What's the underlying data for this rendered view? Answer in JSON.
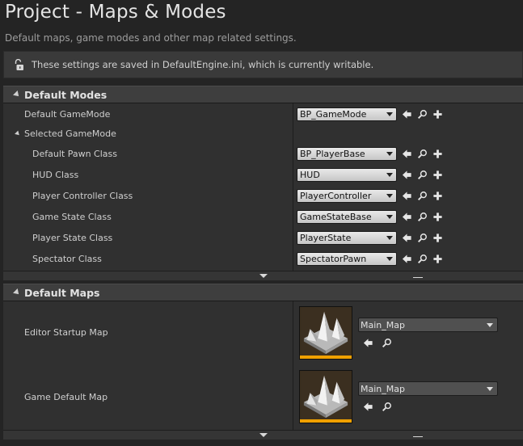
{
  "page": {
    "title": "Project - Maps & Modes",
    "subtitle": "Default maps, game modes and other map related settings."
  },
  "notice": {
    "text": "These settings are saved in DefaultEngine.ini, which is currently writable.",
    "icon": "unlocked-padlock-icon"
  },
  "default_modes": {
    "header": "Default Modes",
    "default_gamemode": {
      "label": "Default GameMode",
      "value": "BP_GameMode"
    },
    "selected_gamemode": {
      "label": "Selected GameMode",
      "rows": [
        {
          "label": "Default Pawn Class",
          "value": "BP_PlayerBase"
        },
        {
          "label": "HUD Class",
          "value": "HUD"
        },
        {
          "label": "Player Controller Class",
          "value": "PlayerController"
        },
        {
          "label": "Game State Class",
          "value": "GameStateBase"
        },
        {
          "label": "Player State Class",
          "value": "PlayerState"
        },
        {
          "label": "Spectator Class",
          "value": "SpectatorPawn"
        }
      ]
    }
  },
  "default_maps": {
    "header": "Default Maps",
    "rows": [
      {
        "label": "Editor Startup Map",
        "value": "Main_Map"
      },
      {
        "label": "Game Default Map",
        "value": "Main_Map"
      }
    ]
  },
  "colors": {
    "accent_orange": "#f0a000",
    "background": "#242424",
    "panel": "#303030"
  }
}
